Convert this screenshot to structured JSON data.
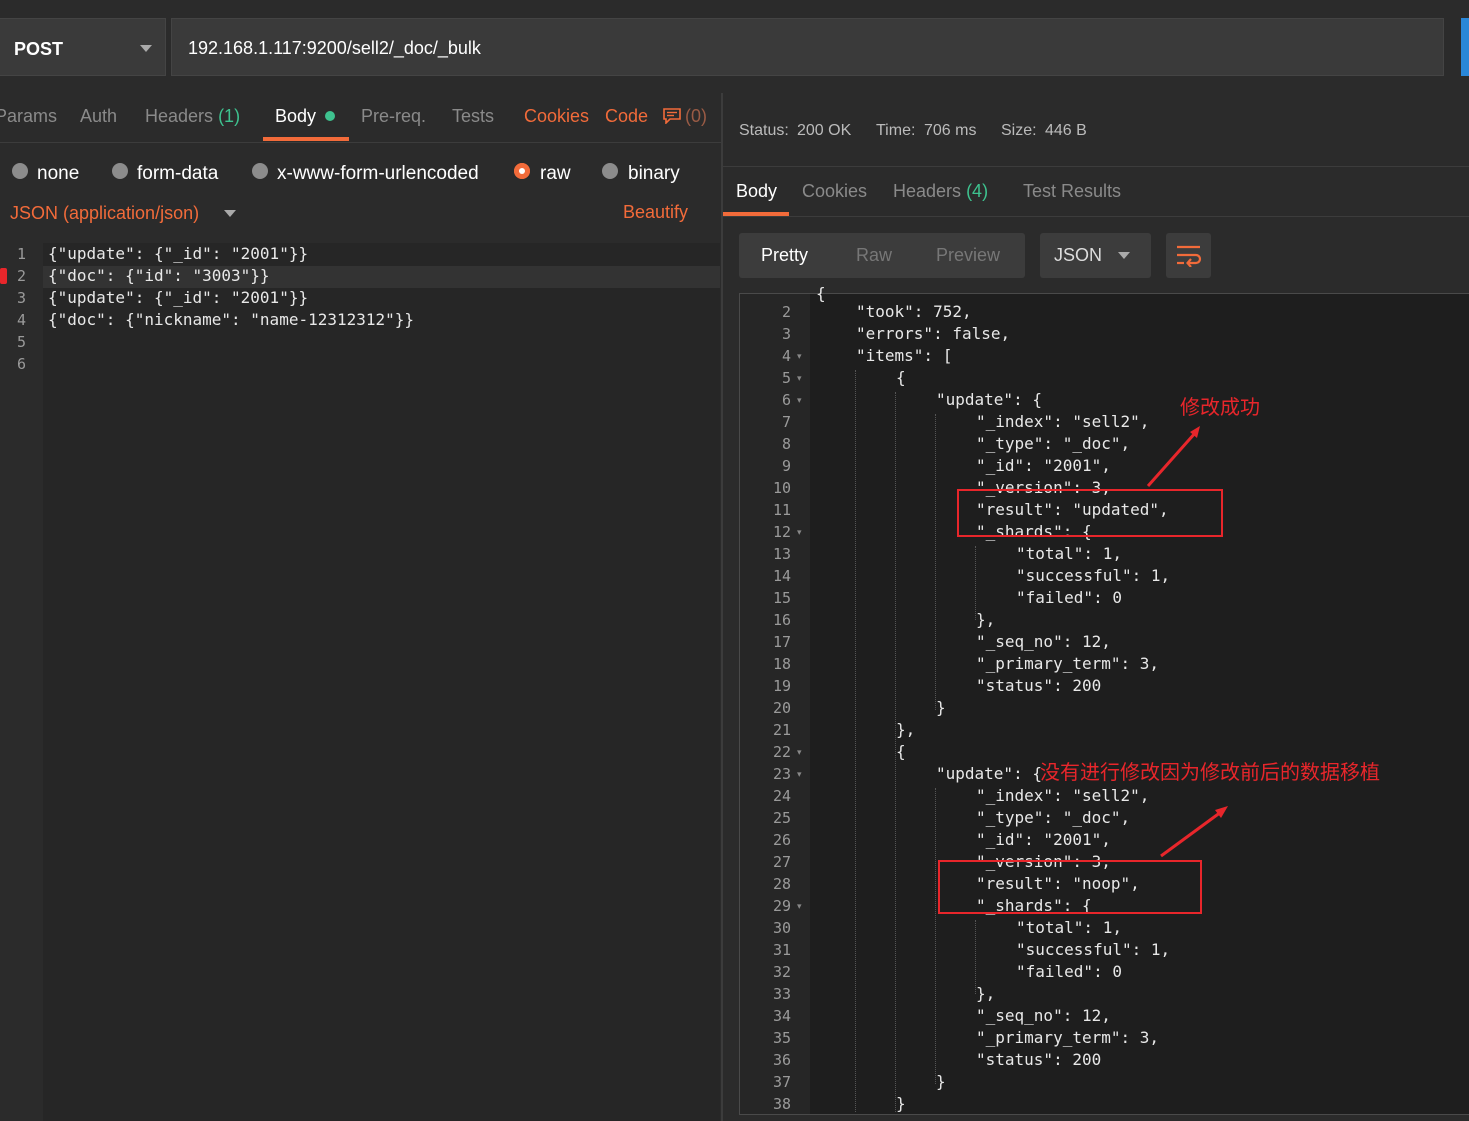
{
  "request": {
    "method": "POST",
    "url": "192.168.1.117:9200/sell2/_doc/_bulk"
  },
  "request_tabs": {
    "params": "Params",
    "auth": "Auth",
    "headers": "Headers",
    "headers_count": "(1)",
    "body": "Body",
    "prereq": "Pre-req.",
    "tests": "Tests",
    "cookies": "Cookies",
    "code": "Code",
    "comments_count": "(0)"
  },
  "body_types": {
    "none": "none",
    "form_data": "form-data",
    "urlencoded": "x-www-form-urlencoded",
    "raw": "raw",
    "binary": "binary",
    "selected": "raw"
  },
  "content_type": "JSON (application/json)",
  "beautify": "Beautify",
  "request_lines": [
    {
      "num": "1",
      "text": "{\"update\": {\"_id\": \"2001\"}}"
    },
    {
      "num": "2",
      "text": "{\"doc\": {\"id\": \"3003\"}}"
    },
    {
      "num": "3",
      "text": "{\"update\": {\"_id\": \"2001\"}}"
    },
    {
      "num": "4",
      "text": "{\"doc\": {\"nickname\": \"name-12312312\"}}"
    },
    {
      "num": "5",
      "text": ""
    },
    {
      "num": "6",
      "text": ""
    }
  ],
  "response_meta": {
    "status_label": "Status:",
    "status_value": "200 OK",
    "time_label": "Time:",
    "time_value": "706 ms",
    "size_label": "Size:",
    "size_value": "446 B"
  },
  "response_tabs": {
    "body": "Body",
    "cookies": "Cookies",
    "headers": "Headers",
    "headers_count": "(4)",
    "test_results": "Test Results"
  },
  "view_modes": {
    "pretty": "Pretty",
    "raw": "Raw",
    "preview": "Preview",
    "format": "JSON"
  },
  "response_lines": [
    {
      "num": "2",
      "text": "\"took\": 752,"
    },
    {
      "num": "3",
      "text": "\"errors\": false,"
    },
    {
      "num": "4",
      "text": "\"items\": ["
    },
    {
      "num": "5",
      "text": "{"
    },
    {
      "num": "6",
      "text": "\"update\": {"
    },
    {
      "num": "7",
      "text": "\"_index\": \"sell2\","
    },
    {
      "num": "8",
      "text": "\"_type\": \"_doc\","
    },
    {
      "num": "9",
      "text": "\"_id\": \"2001\","
    },
    {
      "num": "10",
      "text": "\"_version\": 3,"
    },
    {
      "num": "11",
      "text": "\"result\": \"updated\","
    },
    {
      "num": "12",
      "text": "\"_shards\": {"
    },
    {
      "num": "13",
      "text": "\"total\": 1,"
    },
    {
      "num": "14",
      "text": "\"successful\": 1,"
    },
    {
      "num": "15",
      "text": "\"failed\": 0"
    },
    {
      "num": "16",
      "text": "},"
    },
    {
      "num": "17",
      "text": "\"_seq_no\": 12,"
    },
    {
      "num": "18",
      "text": "\"_primary_term\": 3,"
    },
    {
      "num": "19",
      "text": "\"status\": 200"
    },
    {
      "num": "20",
      "text": "}"
    },
    {
      "num": "21",
      "text": "},"
    },
    {
      "num": "22",
      "text": "{"
    },
    {
      "num": "23",
      "text": "\"update\": {"
    },
    {
      "num": "24",
      "text": "\"_index\": \"sell2\","
    },
    {
      "num": "25",
      "text": "\"_type\": \"_doc\","
    },
    {
      "num": "26",
      "text": "\"_id\": \"2001\","
    },
    {
      "num": "27",
      "text": "\"_version\": 3,"
    },
    {
      "num": "28",
      "text": "\"result\": \"noop\","
    },
    {
      "num": "29",
      "text": "\"_shards\": {"
    },
    {
      "num": "30",
      "text": "\"total\": 1,"
    },
    {
      "num": "31",
      "text": "\"successful\": 1,"
    },
    {
      "num": "32",
      "text": "\"failed\": 0"
    },
    {
      "num": "33",
      "text": "},"
    },
    {
      "num": "34",
      "text": "\"_seq_no\": 12,"
    },
    {
      "num": "35",
      "text": "\"_primary_term\": 3,"
    },
    {
      "num": "36",
      "text": "\"status\": 200"
    },
    {
      "num": "37",
      "text": "}"
    },
    {
      "num": "38",
      "text": "}"
    }
  ],
  "annotations": {
    "success": "修改成功",
    "noop": "没有进行修改因为修改前后的数据移植"
  },
  "colors": {
    "accent": "#f26b3a",
    "status_green": "#3ec28f",
    "annotation_red": "#e8262b",
    "send_blue": "#2a87d8"
  }
}
